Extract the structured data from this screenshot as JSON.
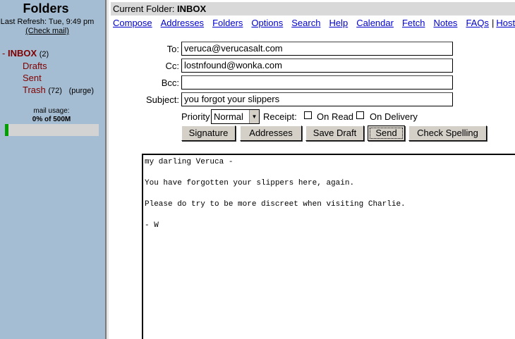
{
  "sidebar": {
    "title": "Folders",
    "last_refresh": "Last Refresh: Tue, 9:49 pm",
    "check_mail": "(Check mail)",
    "folders": [
      {
        "prefix": "- ",
        "name": "INBOX",
        "count": "(2)"
      },
      {
        "name": "Drafts"
      },
      {
        "name": "Sent"
      },
      {
        "name": "Trash",
        "count": "(72)",
        "extra": "(purge)"
      }
    ],
    "usage_label": "mail usage:",
    "usage_value": "0% of 500M",
    "usage_fraction": 0.0
  },
  "header": {
    "current_folder_label": "Current Folder:",
    "current_folder": "INBOX"
  },
  "nav": [
    "Compose",
    "Addresses",
    "Folders",
    "Options",
    "Search",
    "Help",
    "Calendar",
    "Fetch",
    "Notes",
    "FAQs",
    "Hostb"
  ],
  "compose": {
    "to_label": "To:",
    "to_value": "veruca@verucasalt.com",
    "cc_label": "Cc:",
    "cc_value": "lostnfound@wonka.com",
    "bcc_label": "Bcc:",
    "bcc_value": "",
    "subject_label": "Subject:",
    "subject_value": "you forgot your slippers",
    "priority_label": "Priority",
    "priority_value": "Normal",
    "receipt_label": "Receipt:",
    "on_read_label": "On Read",
    "on_delivery_label": "On Delivery",
    "buttons": {
      "signature": "Signature",
      "addresses": "Addresses",
      "save_draft": "Save Draft",
      "send": "Send",
      "check_spelling": "Check Spelling"
    },
    "body_lines": [
      "my darling Veruca -",
      "",
      "You have forgotten your slippers here, again.",
      "",
      "Please do try to be more discreet when visiting Charlie.",
      "",
      "- W"
    ]
  },
  "colors": {
    "sidebar_bg": "#a5bdd2",
    "folder_link": "#800000",
    "nav_link": "#0000cc",
    "usage_fill": "#00a000"
  }
}
